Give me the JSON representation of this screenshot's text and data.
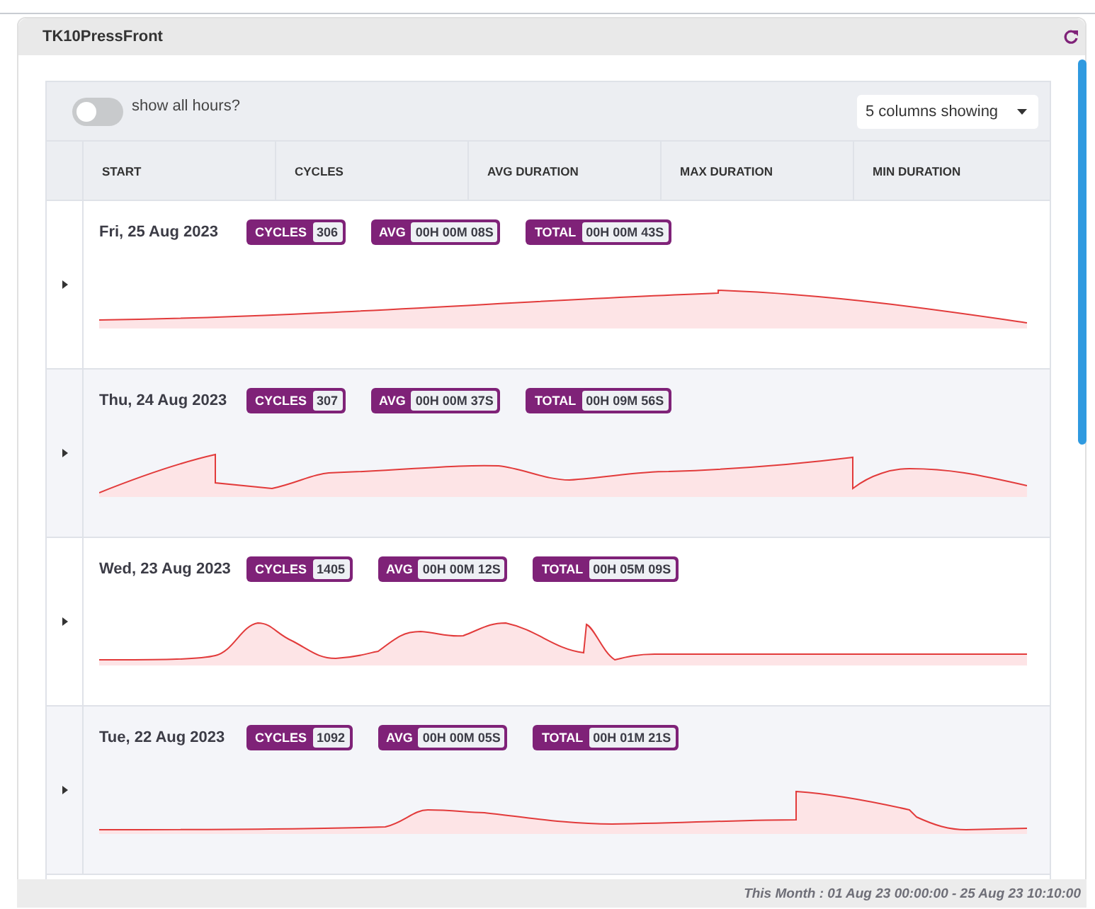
{
  "panel": {
    "title": "TK10PressFront"
  },
  "toggle": {
    "label": "show all hours?",
    "on": false
  },
  "column_select": {
    "value": "5 columns showing"
  },
  "columns": [
    "START",
    "CYCLES",
    "AVG DURATION",
    "MAX DURATION",
    "MIN DURATION"
  ],
  "rows": [
    {
      "date": "Fri, 25 Aug 2023",
      "expanded": false,
      "stats": [
        {
          "label": "CYCLES",
          "value": "306"
        },
        {
          "label": "AVG",
          "value": "00H 00M 08S"
        },
        {
          "label": "TOTAL",
          "value": "00H 00M 43S"
        }
      ]
    },
    {
      "date": "Thu, 24 Aug 2023",
      "expanded": false,
      "stats": [
        {
          "label": "CYCLES",
          "value": "307"
        },
        {
          "label": "AVG",
          "value": "00H 00M 37S"
        },
        {
          "label": "TOTAL",
          "value": "00H 09M 56S"
        }
      ]
    },
    {
      "date": "Wed, 23 Aug 2023",
      "expanded": false,
      "stats": [
        {
          "label": "CYCLES",
          "value": "1405"
        },
        {
          "label": "AVG",
          "value": "00H 00M 12S"
        },
        {
          "label": "TOTAL",
          "value": "00H 05M 09S"
        }
      ]
    },
    {
      "date": "Tue, 22 Aug 2023",
      "expanded": false,
      "stats": [
        {
          "label": "CYCLES",
          "value": "1092"
        },
        {
          "label": "AVG",
          "value": "00H 00M 05S"
        },
        {
          "label": "TOTAL",
          "value": "00H 01M 21S"
        }
      ]
    }
  ],
  "footer": {
    "range": "This Month : 01 Aug 23 00:00:00 - 25 Aug 23 10:10:00"
  }
}
